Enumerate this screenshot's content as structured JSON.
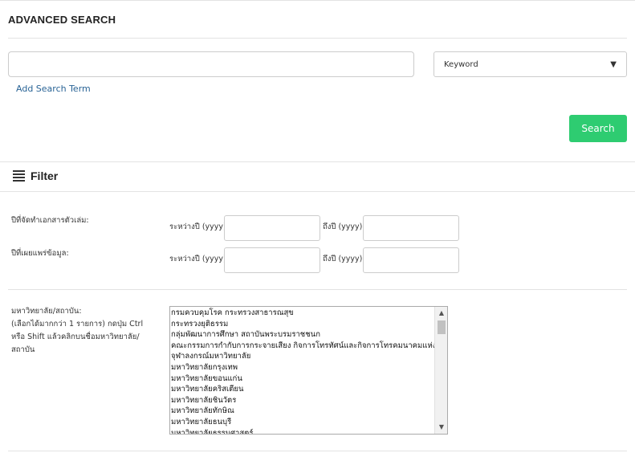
{
  "header": {
    "title": "ADVANCED SEARCH"
  },
  "search": {
    "input_value": "",
    "field_select": "Keyword",
    "add_term": "Add Search Term",
    "button": "Search"
  },
  "filter": {
    "title": "Filter",
    "rows": [
      {
        "label": "ปีที่จัดทำเอกสารตัวเล่ม:",
        "from_label": "ระหว่างปี (yyyy)",
        "to_label": "ถึงปี (yyyy)"
      },
      {
        "label": "ปีที่เผยแพร่ข้อมูล:",
        "from_label": "ระหว่างปี (yyyy)",
        "to_label": "ถึงปี (yyyy)"
      }
    ],
    "university": {
      "label_lines": [
        "มหาวิทยาลัย/สถาบัน:",
        "(เลือกได้มากกว่า 1 รายการ) กดปุ่ม Ctrl",
        "หรือ Shift แล้วคลิกบนชื่อมหาวิทยาลัย/",
        "สถาบัน"
      ],
      "options": [
        "กรมควบคุมโรค กระทรวงสาธารณสุข",
        "กระทรวงยุติธรรม",
        "กลุ่มพัฒนาการศึกษา สถาบันพระบรมราชชนก",
        "คณะกรรมการกำกับการกระจายเสียง กิจการโทรทัศน์และกิจการโทรคมนาคมแห่งชาติ",
        "จุฬาลงกรณ์มหาวิทยาลัย",
        "มหาวิทยาลัยกรุงเทพ",
        "มหาวิทยาลัยขอนแก่น",
        "มหาวิทยาลัยคริสเตียน",
        "มหาวิทยาลัยชินวัตร",
        "มหาวิทยาลัยทักษิณ",
        "มหาวิทยาลัยธนบุรี",
        "มหาวิทยาลัยธรรมศาสตร์"
      ]
    }
  },
  "icons": {
    "filter": "hamburger-icon",
    "dropdown": "caret-down-icon"
  },
  "colors": {
    "accent": "#2ecc71",
    "link": "#2a6496"
  }
}
